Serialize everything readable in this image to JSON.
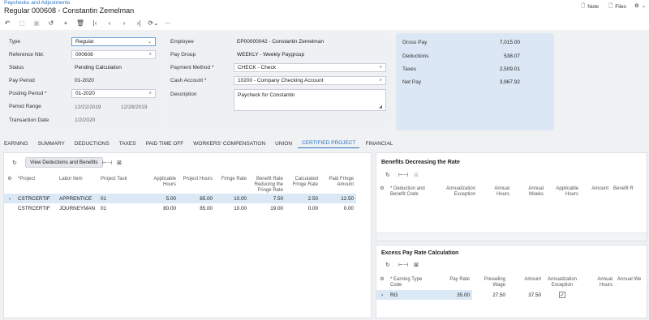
{
  "breadcrumb": "Paychecks and Adjustments",
  "title": "Regular 000608 - Constantin Zemelman",
  "header_actions": {
    "note": "Note",
    "files": "Files"
  },
  "toolbar_icons": [
    "undo-icon",
    "save-icon",
    "save-close-icon",
    "cancel-icon",
    "add-icon",
    "delete-icon",
    "first-icon",
    "prev-icon",
    "next-icon",
    "last-icon",
    "refresh-icon",
    "more-icon"
  ],
  "form": {
    "type_label": "Type",
    "type_value": "Regular",
    "ref_label": "Reference Nbr.",
    "ref_value": "000608",
    "status_label": "Status",
    "status_value": "Pending Calculation",
    "pay_period_label": "Pay Period",
    "pay_period_value": "01-2020",
    "posting_period_label": "Posting Period",
    "posting_period_value": "01-2020",
    "period_range_label": "Period Range",
    "period_start": "12/22/2019",
    "period_end": "12/28/2019",
    "transaction_date_label": "Transaction Date",
    "transaction_date_value": "1/2/2020",
    "employee_label": "Employee",
    "employee_value": "EP00000042 - Constantin Zemelman",
    "pay_group_label": "Pay Group",
    "pay_group_value": "WEEKLY - Weekly Paygroup",
    "payment_method_label": "Payment Method",
    "payment_method_value": "CHECK - Check",
    "cash_account_label": "Cash Account",
    "cash_account_value": "10200 - Company Checking Account",
    "description_label": "Description",
    "description_value": "Paycheck for Constantin"
  },
  "totals": {
    "gross_pay_label": "Gross Pay",
    "gross_pay": "7,015.00",
    "deductions_label": "Deductions",
    "deductions": "538.07",
    "taxes_label": "Taxes",
    "taxes": "2,509.01",
    "net_pay_label": "Net Pay",
    "net_pay": "3,967.92"
  },
  "tabs": [
    "EARNING",
    "SUMMARY",
    "DEDUCTIONS",
    "TAXES",
    "PAID TIME OFF",
    "WORKERS' COMPENSATION",
    "UNION",
    "CERTIFIED PROJECT",
    "FINANCIAL"
  ],
  "active_tab": "CERTIFIED PROJECT",
  "main_grid": {
    "button": "View Deductions and Benefits",
    "columns": [
      "*Project",
      "Labor Item",
      "Project Task",
      "Applicable Hours",
      "Project Hours",
      "Fringe Rate",
      "Benefit Rate Reducing the Fringe Rate",
      "Calculated Fringe Rate",
      "Paid Fringe Amount"
    ],
    "rows": [
      [
        "CSTRCERTIF",
        "APPRENTICE",
        "01",
        "5.00",
        "85.00",
        "10.00",
        "7.50",
        "2.50",
        "12.50"
      ],
      [
        "CSTRCERTIF",
        "JOURNEYMAN",
        "01",
        "80.00",
        "85.00",
        "10.00",
        "19.00",
        "0.00",
        "0.00"
      ]
    ]
  },
  "benefits_grid": {
    "title": "Benefits Decreasing the Rate",
    "columns": [
      "* Deduction and Benefit Code",
      "Annualization Exception",
      "Annual Hours",
      "Annual Weeks",
      "Applicable Hours",
      "Amount",
      "Benefit R"
    ]
  },
  "excess_grid": {
    "title": "Excess Pay Rate Calculation",
    "columns": [
      "* Earning Type Code",
      "Pay Rate",
      "Prevailing Wage",
      "Amount",
      "Annualization Exception",
      "Annual Hours",
      "Annual We"
    ],
    "rows": [
      [
        "RG",
        "35.00",
        "27.50",
        "37.50",
        "✓",
        "",
        ""
      ]
    ]
  }
}
